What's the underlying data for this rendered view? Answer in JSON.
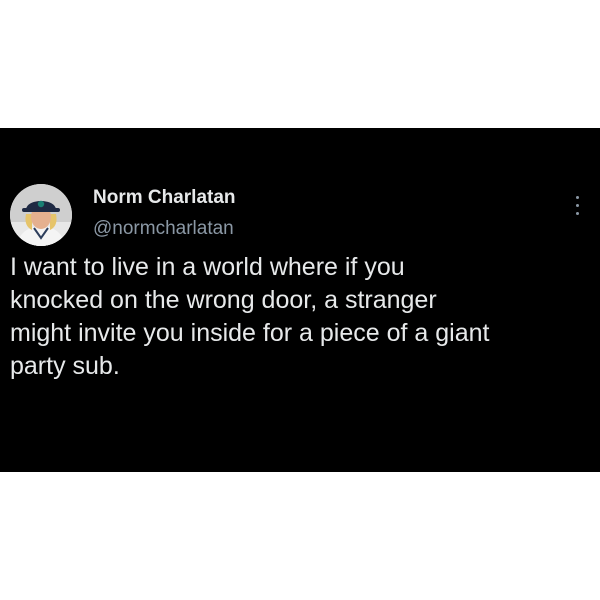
{
  "tweet": {
    "author": {
      "display_name": "Norm Charlatan",
      "handle": "@normcharlatan",
      "avatar_icon": "baseball-player-avatar"
    },
    "more_icon": "vertical-ellipsis-icon",
    "text_lines": [
      "I want to live in a world where if you",
      "knocked on the wrong door, a stranger",
      "might invite you inside for a piece of a giant",
      "party sub."
    ]
  },
  "colors": {
    "card_background": "#000000",
    "page_background": "#ffffff",
    "primary_text": "#e7e9ea",
    "secondary_text": "#8b98a5"
  }
}
